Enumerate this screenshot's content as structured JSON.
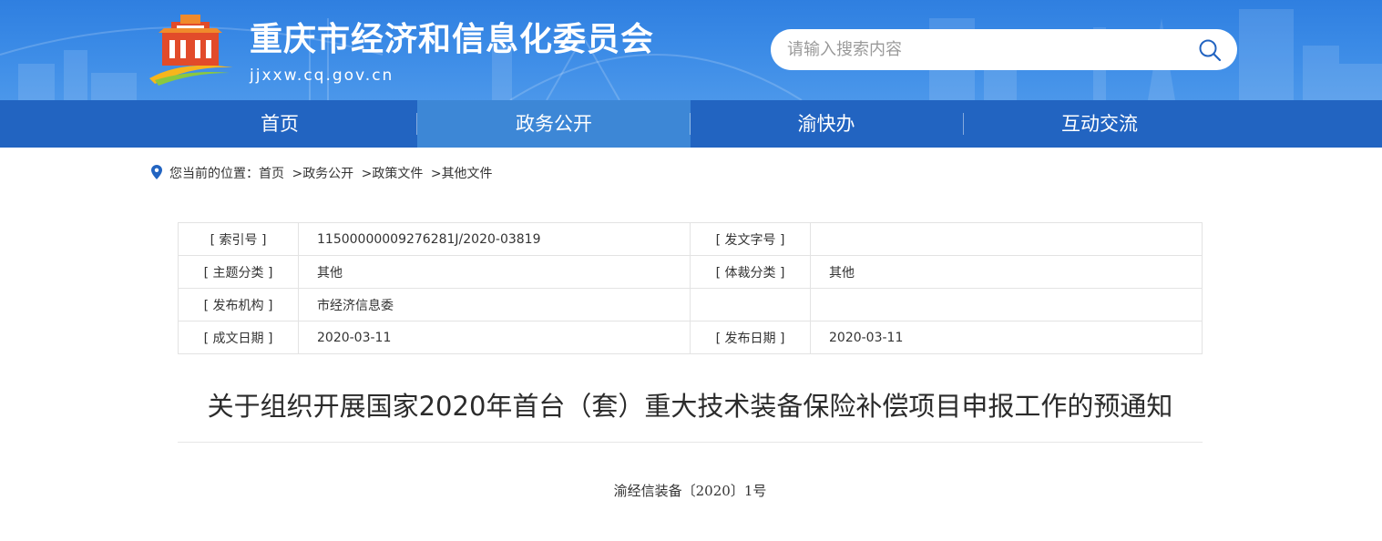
{
  "header": {
    "site_title": "重庆市经济和信息化委员会",
    "site_url": "jjxxw.cq.gov.cn",
    "search_placeholder": "请输入搜索内容"
  },
  "nav": {
    "items": [
      {
        "label": "首页"
      },
      {
        "label": "政务公开"
      },
      {
        "label": "渝快办"
      },
      {
        "label": "互动交流"
      }
    ],
    "active_index": 1
  },
  "breadcrumb": {
    "prefix": "您当前的位置：",
    "items": [
      "首页",
      "政务公开",
      "政策文件",
      "其他文件"
    ],
    "separator": ">"
  },
  "meta": {
    "rows": [
      {
        "label1": "[ 索引号 ]",
        "value1": "11500000009276281J/2020-03819",
        "label2": "[ 发文字号 ]",
        "value2": ""
      },
      {
        "label1": "[ 主题分类 ]",
        "value1": "其他",
        "label2": "[ 体裁分类 ]",
        "value2": "其他"
      },
      {
        "label1": "[ 发布机构 ]",
        "value1": "市经济信息委",
        "label2": "",
        "value2": ""
      },
      {
        "label1": "[ 成文日期 ]",
        "value1": "2020-03-11",
        "label2": "[ 发布日期 ]",
        "value2": "2020-03-11"
      }
    ]
  },
  "article": {
    "title": "关于组织开展国家2020年首台（套）重大技术装备保险补偿项目申报工作的预通知",
    "doc_number": "渝经信装备〔2020〕1号"
  },
  "colors": {
    "banner": "#3a8ae6",
    "nav_bg": "#2264c1",
    "nav_active": "#3d87d6"
  },
  "icons": {
    "search": "search-icon",
    "location": "location-pin-icon",
    "logo": "site-logo"
  }
}
